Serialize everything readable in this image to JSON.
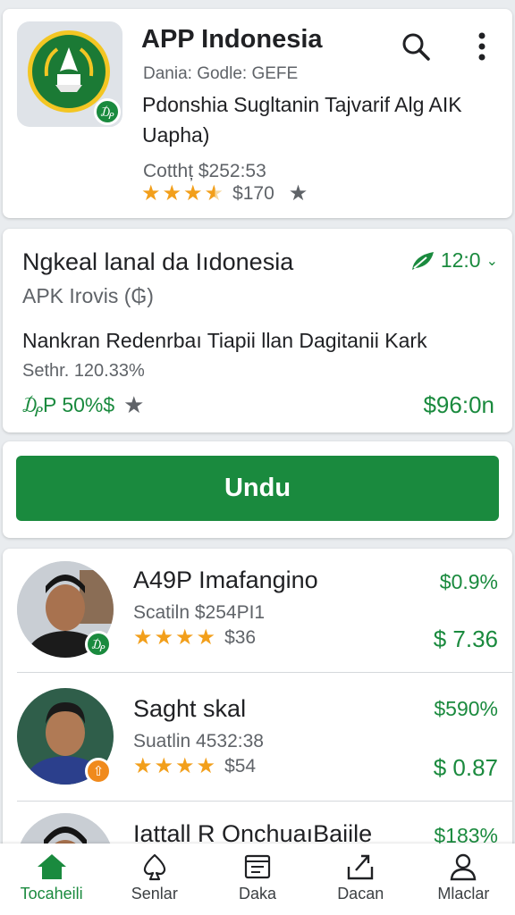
{
  "header": {
    "title": "APP Indonesia",
    "developer": "Dania: Godle: GEFE",
    "description": "Pdonshia Sugltanin Tajvarif Alg AIK Uapha)",
    "cost": "Cotthț $252:53",
    "rating": 3.5,
    "rating_count": "$170",
    "icons": [
      "search-icon",
      "more-vert-icon",
      "star-icon"
    ]
  },
  "info": {
    "title": "Ngkeal lanal da Iıdonesia",
    "subtitle": "APK Irovis (₲)",
    "version": "12:0",
    "description": "Nankran Redenrbaı Tiapii llan Dagitanii Kark",
    "sethr": "Sethr. 120.33%",
    "discount": "₯P 50%$",
    "price": "$96:0n",
    "accent": "#1a8a3e"
  },
  "install": {
    "label": "Undu"
  },
  "list": [
    {
      "name": "A49P Imafangino",
      "sub": "Scatiln $254PI1",
      "rating": 4,
      "count": "$36",
      "pct": "$0.9%",
      "price": "$ 7.36",
      "badge_color": "#1a8a3e",
      "badge_icon": "₯"
    },
    {
      "name": "Saght skal",
      "sub": "Suatlin 4532:38",
      "rating": 4,
      "count": "$54",
      "pct": "$590%",
      "price": "$ 0.87",
      "badge_color": "#f08a1c",
      "badge_icon": "⇧"
    },
    {
      "name": "Iattall R OnchuaıBaiile",
      "sub": "",
      "rating": 0,
      "count": "",
      "pct": "$183%",
      "price": ""
    }
  ],
  "nav": [
    {
      "label": "Tocaheili",
      "icon": "home-icon",
      "active": true
    },
    {
      "label": "Senlar",
      "icon": "spade-icon",
      "active": false
    },
    {
      "label": "Daka",
      "icon": "document-icon",
      "active": false
    },
    {
      "label": "Dacan",
      "icon": "share-icon",
      "active": false
    },
    {
      "label": "Mlaclar",
      "icon": "person-icon",
      "active": false
    }
  ]
}
